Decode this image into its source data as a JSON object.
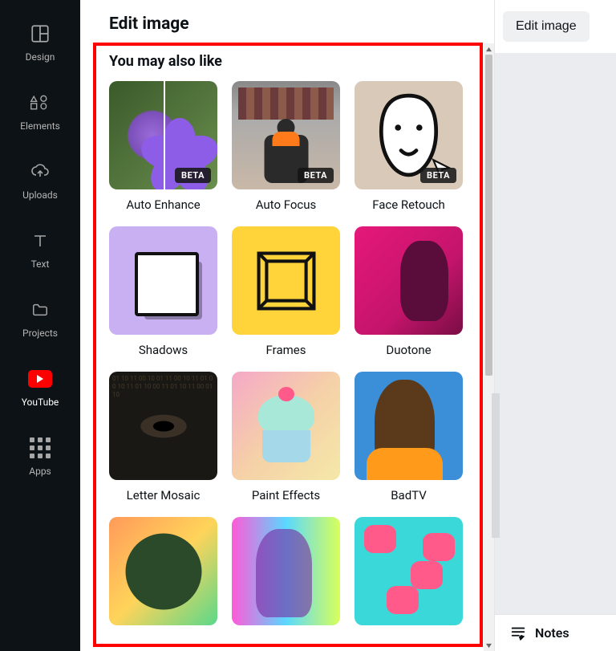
{
  "sidebar": {
    "items": [
      {
        "label": "Design"
      },
      {
        "label": "Elements"
      },
      {
        "label": "Uploads"
      },
      {
        "label": "Text"
      },
      {
        "label": "Projects"
      },
      {
        "label": "YouTube"
      },
      {
        "label": "Apps"
      }
    ]
  },
  "panel": {
    "title": "Edit image",
    "section_title": "You may also like",
    "beta_badge": "BETA",
    "tiles": [
      {
        "label": "Auto Enhance",
        "beta": true
      },
      {
        "label": "Auto Focus",
        "beta": true
      },
      {
        "label": "Face Retouch",
        "beta": true
      },
      {
        "label": "Shadows",
        "beta": false
      },
      {
        "label": "Frames",
        "beta": false
      },
      {
        "label": "Duotone",
        "beta": false
      },
      {
        "label": "Letter Mosaic",
        "beta": false
      },
      {
        "label": "Paint Effects",
        "beta": false
      },
      {
        "label": "BadTV",
        "beta": false
      }
    ]
  },
  "top_button": "Edit image",
  "notes_label": "Notes"
}
